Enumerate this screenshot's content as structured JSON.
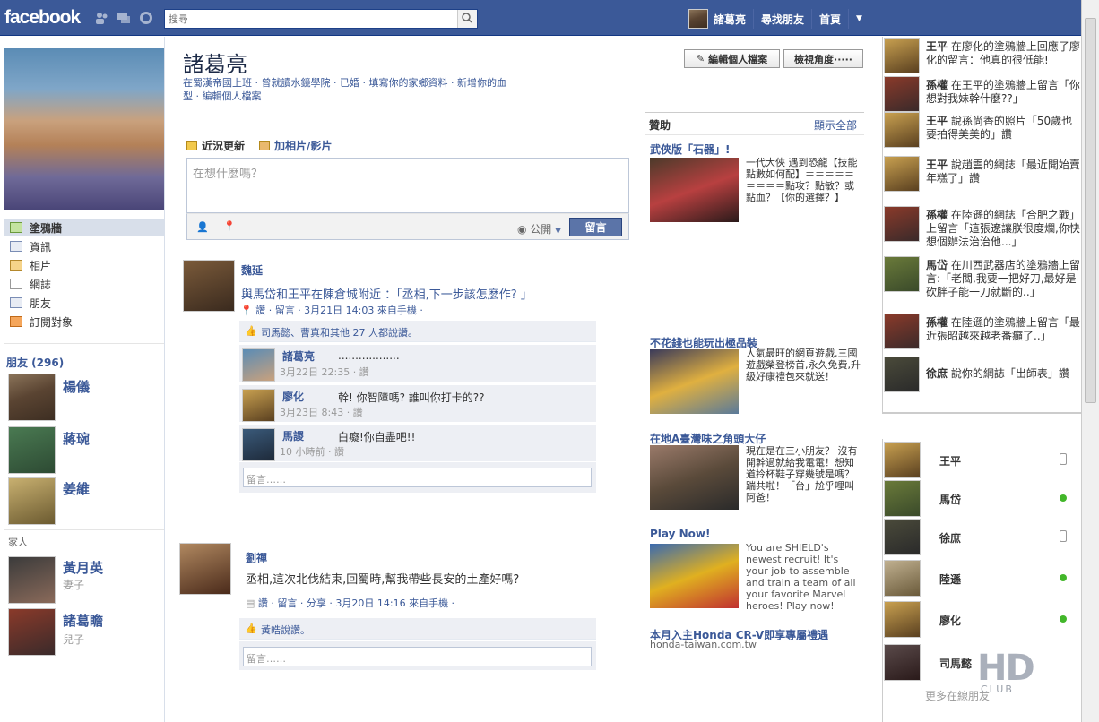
{
  "header": {
    "logo": "facebook",
    "search_placeholder": "搜尋",
    "user_name": "諸葛亮",
    "find_friends": "尋找朋友",
    "home": "首頁"
  },
  "left": {
    "nav": [
      "塗鴉牆",
      "資訊",
      "相片",
      "網誌",
      "朋友",
      "訂閱對象"
    ],
    "friends_title": "朋友 (296)",
    "friends": [
      "楊儀",
      "蔣琬",
      "姜維"
    ],
    "family_title": "家人",
    "family": [
      {
        "name": "黃月英",
        "rel": "妻子"
      },
      {
        "name": "諸葛瞻",
        "rel": "兒子"
      }
    ]
  },
  "profile": {
    "name": "諸葛亮",
    "edit_profile": "編輯個人檔案",
    "view_as": "檢視角度·····",
    "info_line1": "在蜀漢帝國上班 · 曾就讀水鏡學院 · 已婚 · 填寫你的家鄉資料 · 新增你的血",
    "info_line2": "型 · 編輯個人檔案"
  },
  "composer": {
    "tab_status": "近況更新",
    "tab_photo": "加相片/影片",
    "placeholder": "在想什麼嗎？",
    "privacy": "公開",
    "post_button": "留言"
  },
  "posts": [
    {
      "author": "魏延",
      "text": "與馬岱和王平在陳倉城附近 ：「丞相,下一步該怎麼作? 」",
      "meta": "讚 · 留言 · 3月21日 14:03 來自手機 ·",
      "likes": "司馬懿、曹真和其他 27 人都說讚。",
      "comments": [
        {
          "name": "諸葛亮",
          "text": "..................",
          "meta": "3月22日 22:35 · 讚"
        },
        {
          "name": "廖化",
          "text": "幹! 你智障嗎? 誰叫你打卡的??",
          "meta": "3月23日 8:43 · 讚"
        },
        {
          "name": "馬謖",
          "text": "白癡!你自盡吧!!",
          "meta": "10 小時前 · 讚"
        }
      ],
      "comment_placeholder": "留言……"
    },
    {
      "author": "劉禪",
      "text": "丞相,這次北伐結束,回蜀時,幫我帶些長安的土產好嗎?",
      "meta": "讚 · 留言 · 分享 · 3月20日 14:16 來自手機 ·",
      "likes": "黃皓說讚。",
      "comment_placeholder": "留言……"
    }
  ],
  "sponsored": {
    "title": "贊助",
    "see_all": "顯示全部",
    "ads": [
      {
        "title": "武俠版「石器」!",
        "text": "一代大俠 遇到恐龍【技能點數如何配】＝＝＝＝＝＝＝＝＝點攻？點敏？或點血？【你的選擇？】"
      },
      {
        "title": "不花錢也能玩出極品裝",
        "text": "人氣最旺的網頁遊戲,三國遊戲榮登榜首,永久免費,升級好康禮包來就送！"
      },
      {
        "title": "在地A臺灣味之角頭大仔",
        "text": "現在是在三小朋友？ 沒有開幹過就給我電電！想知道拎杯鞋子穿幾號是嗎？ 踹共啦！「台」尬乎哩叫阿爸！"
      },
      {
        "title": "Play Now!",
        "text": "You are SHIELD's newest recruit! It's your job to assemble and train a team of all your favorite Marvel heroes! Play now!"
      },
      {
        "title": "本月入主Honda CR-V即享專屬禮遇",
        "text": "honda-taiwan.com.tw"
      }
    ]
  },
  "ticker": [
    {
      "name": "王平",
      "text": "在廖化的塗鴉牆上回應了廖化的留言：他真的很低能!"
    },
    {
      "name": "孫權",
      "text": "在王平的塗鴉牆上留言「你想對我妹幹什麼??」"
    },
    {
      "name": "王平",
      "text": "說孫尚香的照片「50歲也要拍得美美的」讚"
    },
    {
      "name": "王平",
      "text": "說趙雲的網誌「最近開始賣年糕了」讚"
    },
    {
      "name": "孫權",
      "text": "在陸遜的網誌「合肥之戰」上留言「這張遼讓朕很度爛,你快想個辦法治治他...」"
    },
    {
      "name": "馬岱",
      "text": "在川西武器店的塗鴉牆上留言:「老闆,我要一把好刀,最好是砍胖子能一刀就斷的..」"
    },
    {
      "name": "孫權",
      "text": "在陸遜的塗鴉牆上留言「最近張昭越來越老番癲了..」"
    },
    {
      "name": "徐庶",
      "text": "說你的網誌「出師表」讚"
    }
  ],
  "chat": [
    {
      "name": "王平",
      "status": "mobile"
    },
    {
      "name": "馬岱",
      "status": "online"
    },
    {
      "name": "徐庶",
      "status": "mobile"
    },
    {
      "name": "陸遜",
      "status": "online"
    },
    {
      "name": "廖化",
      "status": "online"
    },
    {
      "name": "司馬懿",
      "status": "none"
    }
  ],
  "chat_more": "更多在線朋友",
  "watermark": "HD",
  "watermark_sub": "CLUB",
  "colors": {
    "brand": "#3b5998",
    "online": "#42b72a"
  }
}
